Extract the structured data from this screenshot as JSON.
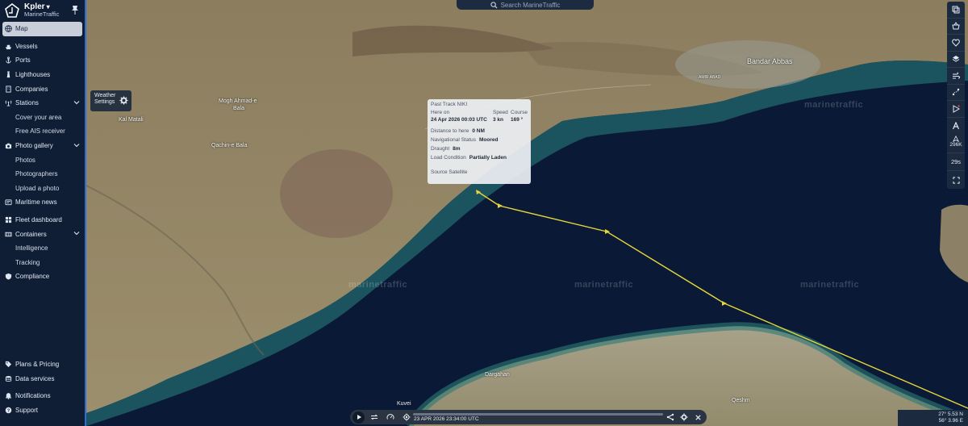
{
  "brand": {
    "org": "Kpler",
    "app": "MarineTraffic"
  },
  "sidebar": {
    "items": [
      {
        "label": "Map",
        "icon": "globe-icon",
        "active": true
      },
      {
        "label": "Vessels",
        "icon": "ship-icon"
      },
      {
        "label": "Ports",
        "icon": "anchor-icon"
      },
      {
        "label": "Lighthouses",
        "icon": "lighthouse-icon"
      },
      {
        "label": "Companies",
        "icon": "building-icon"
      },
      {
        "label": "Stations",
        "icon": "antenna-icon",
        "expanded": true,
        "children": [
          "Cover your area",
          "Free AIS receiver"
        ]
      },
      {
        "label": "Photo gallery",
        "icon": "camera-icon",
        "expanded": true,
        "children": [
          "Photos",
          "Photographers",
          "Upload a photo"
        ]
      },
      {
        "label": "Maritime news",
        "icon": "news-icon"
      },
      {
        "label": "Fleet dashboard",
        "icon": "dashboard-icon"
      },
      {
        "label": "Containers",
        "icon": "container-icon",
        "expanded": true,
        "children": [
          "Intelligence",
          "Tracking"
        ]
      },
      {
        "label": "Compliance",
        "icon": "shield-icon"
      }
    ],
    "bottom": [
      {
        "label": "Plans & Pricing",
        "icon": "tag-icon"
      },
      {
        "label": "Data services",
        "icon": "database-icon"
      },
      {
        "label": "Notifications",
        "icon": "bell-icon"
      },
      {
        "label": "Support",
        "icon": "help-icon"
      }
    ]
  },
  "search": {
    "placeholder": "Search MarineTraffic"
  },
  "weather": {
    "line1": "Weather",
    "line2": "Settings"
  },
  "popup": {
    "title": "Past Track NIKI",
    "here_on_label": "Here on",
    "here_on_value": "24 Apr 2026 00:03 UTC",
    "speed_label": "Speed",
    "speed_value": "3 kn",
    "course_label": "Course",
    "course_value": "169 °",
    "distance_label": "Distance to here",
    "distance_value": "0 NM",
    "nav_status_label": "Navigational Status",
    "nav_status_value": "Moored",
    "draught_label": "Draught",
    "draught_value": "8m",
    "load_label": "Load Condition",
    "load_value": "Partially Laden",
    "source": "Source Satellite"
  },
  "map_labels": {
    "bandar_abbas": "Bandar Abbas",
    "kal_matali": "Kal Matali",
    "moogh": "Mogh Ahmad-e",
    "moogh2": "Bala",
    "qachin": "Qachin-e Bala",
    "dargahan": "Dargahan",
    "kuvei": "Kuvei",
    "qeshm": "Qeshm",
    "amir_abad": "AMIR ABAD",
    "watermark": "marinetraffic"
  },
  "right_tools": {
    "icons": [
      "layers-stack-icon",
      "basket-icon",
      "heart-icon",
      "layers-icon",
      "weather-icon",
      "route-icon",
      "play-route-icon",
      "font-icon"
    ],
    "zoom_label": "296K",
    "refresh_label": "29s"
  },
  "player": {
    "time": "23 APR 2026 23:34:00 UTC"
  },
  "coords": {
    "lat": "27° 5.53 N",
    "lon": "56° 3.96 E"
  },
  "colors": {
    "sidebar_bg": "#0f1d35",
    "accent": "#2b6fd6",
    "track": "#e6d63a",
    "sea": "#0a1a36"
  }
}
